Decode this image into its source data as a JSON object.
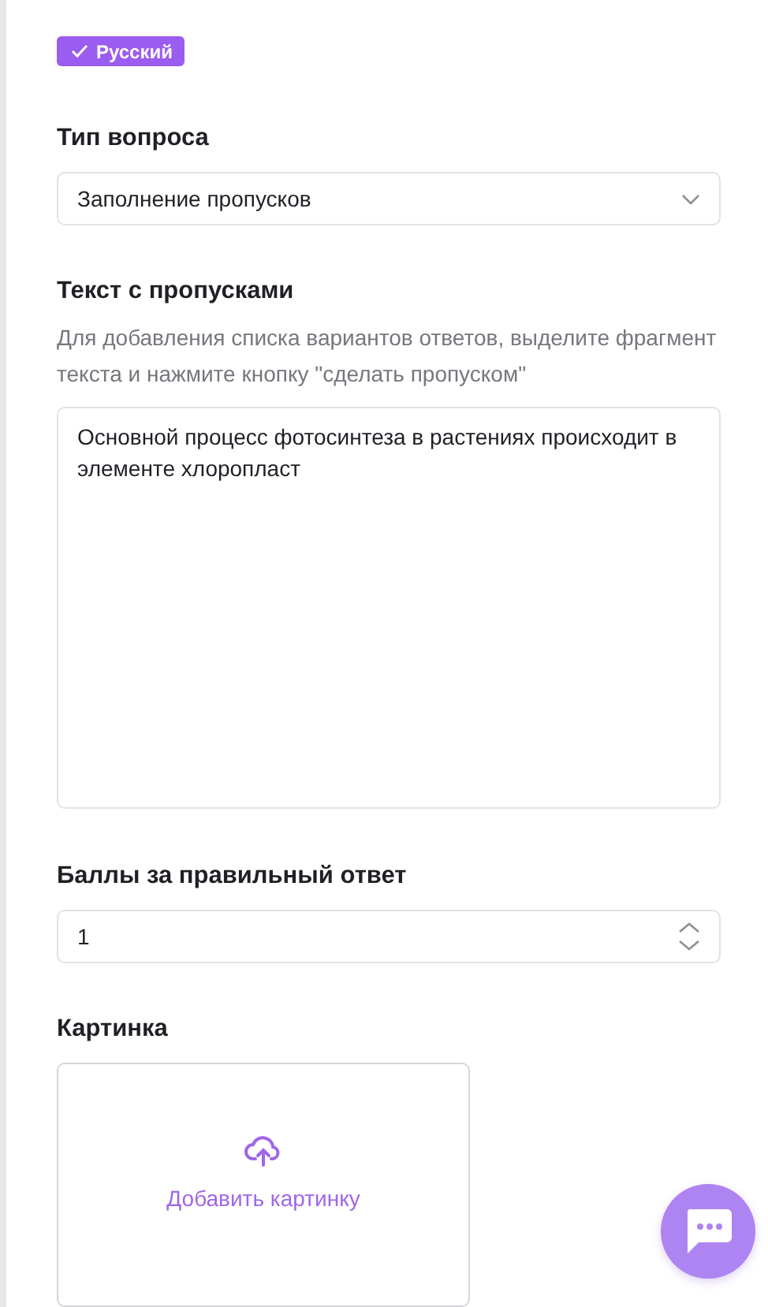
{
  "language_tag": {
    "label": "Русский",
    "selected": true
  },
  "question_type": {
    "label": "Тип вопроса",
    "value": "Заполнение пропусков"
  },
  "gap_text": {
    "label": "Текст с пропусками",
    "hint": "Для добавления списка вариантов ответов, выделите фрагмент текста и нажмите кнопку \"сделать пропуском\"",
    "value": "Основной процесс фотосинтеза в растениях происходит в элементе хлоропласт"
  },
  "points": {
    "label": "Баллы за правильный ответ",
    "value": "1"
  },
  "image": {
    "label": "Картинка",
    "button": "Добавить картинку"
  }
}
